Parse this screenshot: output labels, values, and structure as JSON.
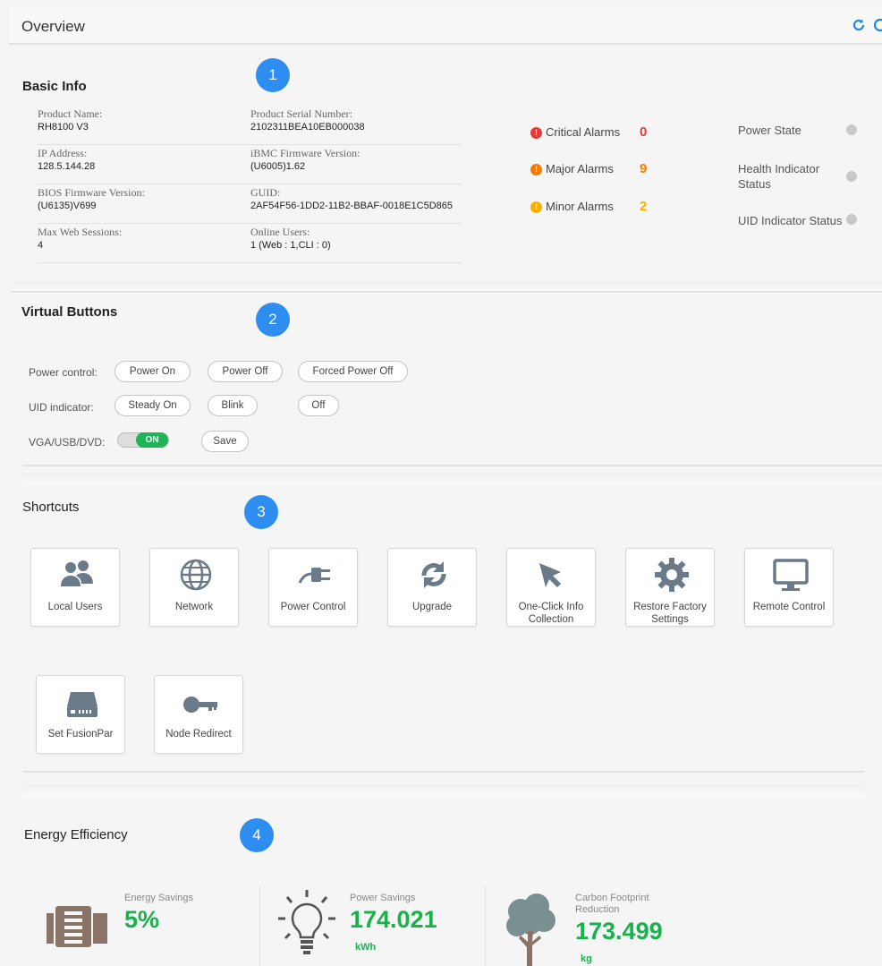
{
  "header": {
    "title": "Overview",
    "refresh_icon": "refresh-icon",
    "help_icon": "help-icon",
    "accent": "#1e88e5"
  },
  "badges": [
    "1",
    "2",
    "3",
    "4"
  ],
  "basic_info": {
    "title": "Basic Info",
    "rows": [
      {
        "left": {
          "label": "Product  Name:",
          "value": "RH8100 V3"
        },
        "right": {
          "label": "Product Serial Number:",
          "value": "2102311BEA10EB000038"
        }
      },
      {
        "left": {
          "label": "IP Address:",
          "value": "128.5.144.28"
        },
        "right": {
          "label": "iBMC Firmware Version:",
          "value": "(U6005)1.62"
        }
      },
      {
        "left": {
          "label": "BIOS Firmware Version:",
          "value": "(U6135)V699"
        },
        "right": {
          "label": "GUID:",
          "value": "2AF54F56-1DD2-11B2-BBAF-0018E1C5D865"
        }
      },
      {
        "left": {
          "label": "Max Web Sessions:",
          "value": "4"
        },
        "right": {
          "label": "Online Users:",
          "value": "1 (Web : 1,CLI : 0)"
        }
      }
    ],
    "alarms": [
      {
        "label": "Critical Alarms",
        "count": "0",
        "color": "#e53935",
        "glyph": "!"
      },
      {
        "label": "Major Alarms",
        "count": "9",
        "color": "#f57c00",
        "glyph": "!"
      },
      {
        "label": "Minor Alarms",
        "count": "2",
        "color": "#f9b000",
        "glyph": "!"
      }
    ],
    "states": [
      {
        "label": "Power State"
      },
      {
        "label": "Health Indicator Status"
      },
      {
        "label": "UID Indicator Status"
      }
    ]
  },
  "virtual_buttons": {
    "title": "Virtual Buttons",
    "power_label": "Power control:",
    "power_buttons": [
      "Power On",
      "Power Off",
      "Forced Power Off"
    ],
    "uid_label": "UID indicator:",
    "uid_buttons": [
      "Steady On",
      "Blink",
      "Off"
    ],
    "vga_label": "VGA/USB/DVD:",
    "vga_toggle": "ON",
    "save": "Save"
  },
  "shortcuts": {
    "title": "Shortcuts",
    "items": [
      {
        "label": "Local Users",
        "icon": "users-icon"
      },
      {
        "label": "Network",
        "icon": "globe-icon"
      },
      {
        "label": "Power Control",
        "icon": "plug-icon"
      },
      {
        "label": "Upgrade",
        "icon": "sync-icon"
      },
      {
        "label": "One-Click Info Collection",
        "icon": "cursor-icon"
      },
      {
        "label": "Restore Factory Settings",
        "icon": "gear-icon"
      },
      {
        "label": "Remote Control",
        "icon": "monitor-icon"
      },
      {
        "label": "Set FusionPar",
        "icon": "disk-icon"
      },
      {
        "label": "Node Redirect",
        "icon": "key-icon"
      }
    ]
  },
  "energy": {
    "title": "Energy Efficiency",
    "items": [
      {
        "label": "Energy Savings",
        "value": "5%",
        "unit": "",
        "icon": "server-icon"
      },
      {
        "label": "Power Savings",
        "value": "174.021",
        "unit": "kWh",
        "icon": "bulb-icon"
      },
      {
        "label": "Carbon Footprint Reduction",
        "value": "173.499",
        "unit": "kg",
        "icon": "tree-icon"
      }
    ],
    "value_color": "#18b24b"
  }
}
